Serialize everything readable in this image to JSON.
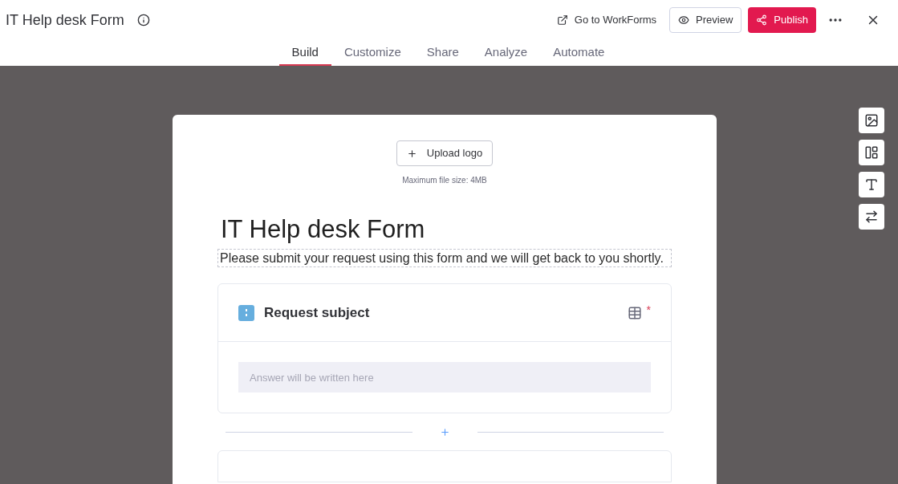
{
  "window": {
    "title": "IT Help desk Form"
  },
  "actions": {
    "go_to": "Go to WorkForms",
    "preview": "Preview",
    "publish": "Publish"
  },
  "tabs": [
    {
      "label": "Build",
      "selected": true
    },
    {
      "label": "Customize",
      "selected": false
    },
    {
      "label": "Share",
      "selected": false
    },
    {
      "label": "Analyze",
      "selected": false
    },
    {
      "label": "Automate",
      "selected": false
    }
  ],
  "form": {
    "upload_button": "Upload logo",
    "upload_hint": "Maximum file size: 4MB",
    "title": "IT Help desk Form",
    "description": "Please submit your request using this form and we will get back to you shortly.",
    "questions": [
      {
        "label": "Request subject",
        "required_mark": "*",
        "placeholder": "Answer will be written here"
      }
    ]
  }
}
